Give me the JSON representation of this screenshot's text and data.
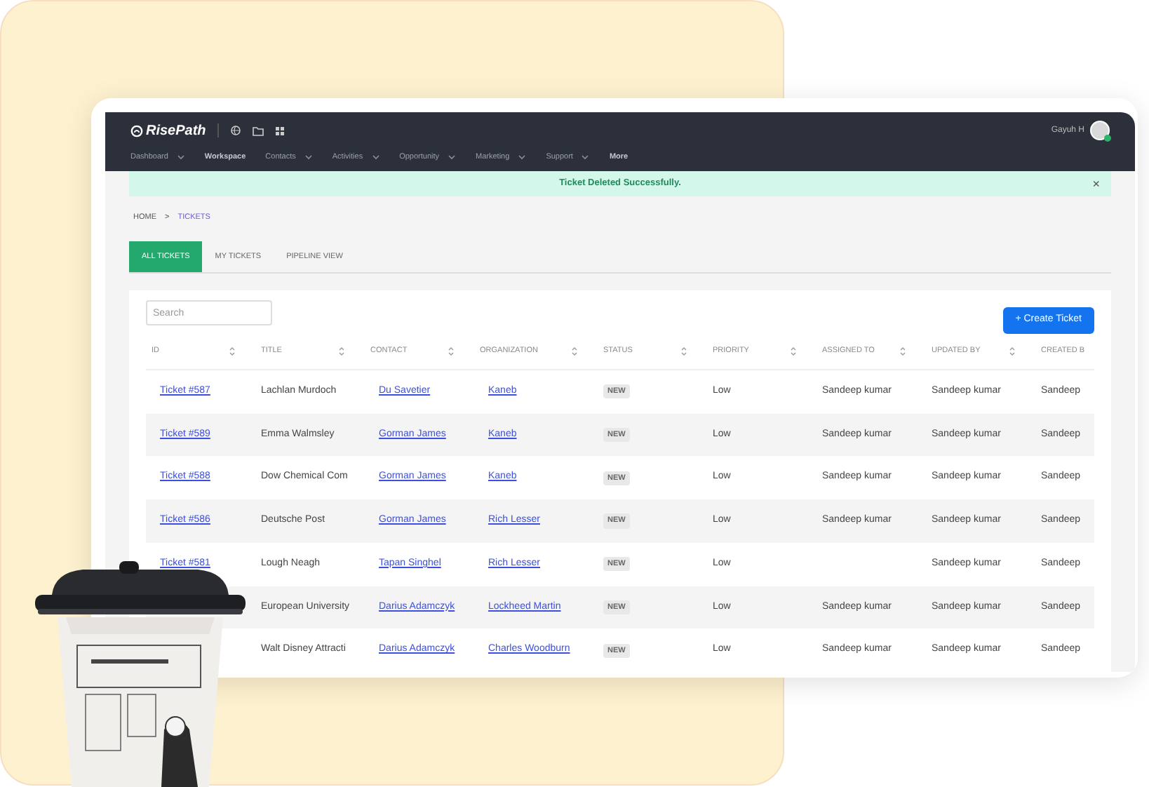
{
  "header": {
    "logo": "RisePath",
    "user": "Gayuh H",
    "online": true
  },
  "nav": [
    {
      "label": "Dashboard",
      "has_menu": true
    },
    {
      "label": "Workspace",
      "has_menu": false
    },
    {
      "label": "Contacts",
      "has_menu": true
    },
    {
      "label": "Activities",
      "has_menu": true
    },
    {
      "label": "Opportunity",
      "has_menu": true
    },
    {
      "label": "Marketing",
      "has_menu": true
    },
    {
      "label": "Support",
      "has_menu": true
    },
    {
      "label": "More",
      "has_menu": false
    }
  ],
  "alert": {
    "message": "Ticket Deleted Successfully.",
    "close": "×"
  },
  "breadcrumb": [
    "HOME",
    ">",
    "TICKETS"
  ],
  "tabs": [
    {
      "label": "ALL TICKETS",
      "selected": true
    },
    {
      "label": "MY TICKETS",
      "selected": false
    },
    {
      "label": "PIPELINE VIEW",
      "selected": false
    }
  ],
  "search": {
    "placeholder": "Search"
  },
  "create_button": "+ Create Ticket",
  "table": {
    "columns": [
      {
        "label": "ID",
        "sortable": true
      },
      {
        "label": "TITLE",
        "sortable": true
      },
      {
        "label": "CONTACT",
        "sortable": true
      },
      {
        "label": "ORGANIZATION",
        "sortable": true
      },
      {
        "label": "STATUS",
        "sortable": true
      },
      {
        "label": "PRIORITY",
        "sortable": true
      },
      {
        "label": "ASSIGNED TO",
        "sortable": true
      },
      {
        "label": "UPDATED BY",
        "sortable": true
      },
      {
        "label": "CREATED B",
        "sortable": false
      }
    ],
    "rows": [
      {
        "id": "Ticket #587",
        "title": "Lachlan Murdoch",
        "contact": "Du Savetier",
        "organization": "Kaneb",
        "status": "NEW",
        "priority": "Low",
        "assigned_to": "Sandeep kumar",
        "updated_by": "Sandeep kumar",
        "created_by": "Sandeep"
      },
      {
        "id": "Ticket #589",
        "title": "Emma Walmsley",
        "contact": "Gorman James",
        "organization": "Kaneb",
        "status": "NEW",
        "priority": "Low",
        "assigned_to": "Sandeep kumar",
        "updated_by": "Sandeep kumar",
        "created_by": "Sandeep"
      },
      {
        "id": "Ticket #588",
        "title": "Dow Chemical Com",
        "contact": "Gorman James",
        "organization": "Kaneb",
        "status": "NEW",
        "priority": "Low",
        "assigned_to": "Sandeep kumar",
        "updated_by": "Sandeep kumar",
        "created_by": "Sandeep"
      },
      {
        "id": "Ticket #586",
        "title": "Deutsche Post",
        "contact": "Gorman James",
        "organization": "Rich Lesser",
        "status": "NEW",
        "priority": "Low",
        "assigned_to": "Sandeep kumar",
        "updated_by": "Sandeep kumar",
        "created_by": "Sandeep"
      },
      {
        "id": "Ticket #581",
        "title": "Lough Neagh",
        "contact": "Tapan Singhel",
        "organization": "Rich Lesser",
        "status": "NEW",
        "priority": "Low",
        "updated_by": "Sandeep kumar",
        "created_by": "Sandeep"
      },
      {
        "title": "European University",
        "contact": "Darius Adamczyk",
        "organization": "Lockheed Martin",
        "status": "NEW",
        "priority": "Low",
        "assigned_to": "Sandeep kumar",
        "updated_by": "Sandeep kumar",
        "created_by": "Sandeep"
      },
      {
        "title": "Walt Disney Attracti",
        "contact": "Darius Adamczyk",
        "organization": "Charles Woodburn",
        "status": "NEW",
        "priority": "Low",
        "assigned_to": "Sandeep kumar",
        "updated_by": "Sandeep kumar",
        "created_by": "Sandeep"
      }
    ]
  }
}
